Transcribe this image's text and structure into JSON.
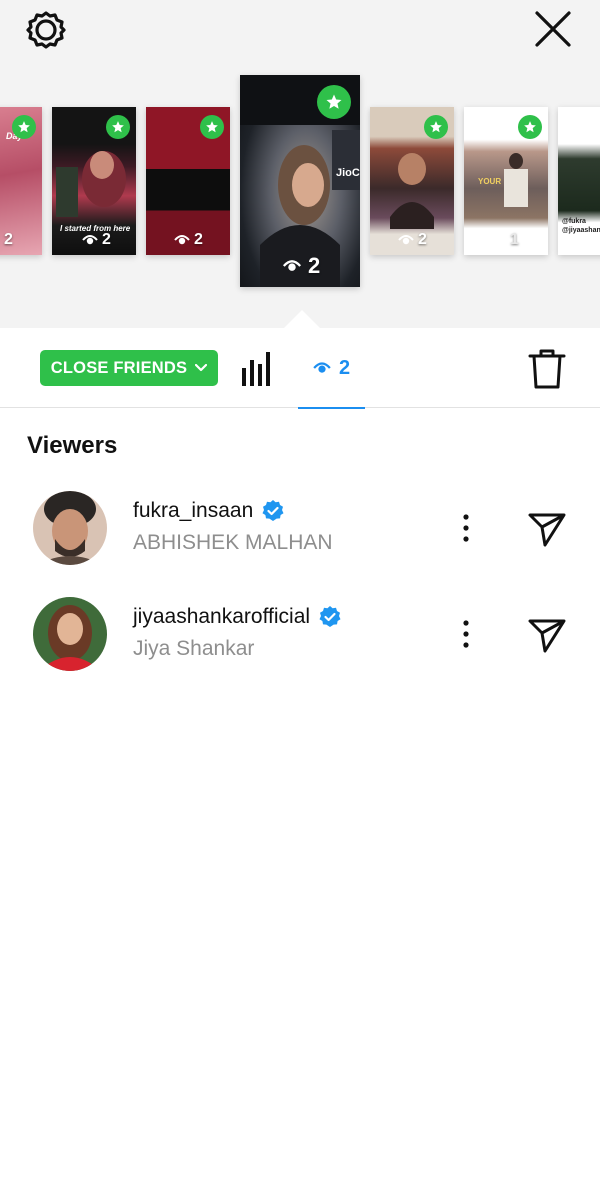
{
  "header": {
    "settings_icon": "gear-icon",
    "close_icon": "close-icon"
  },
  "stories": {
    "items": [
      {
        "caption": "Day",
        "views": "2",
        "close_friends": true
      },
      {
        "caption": "I started from here",
        "views": "2",
        "close_friends": true
      },
      {
        "caption": "",
        "views": "2",
        "close_friends": true
      },
      {
        "caption": "",
        "views": "2",
        "close_friends": true,
        "selected": true,
        "overlay_text": "JioC"
      },
      {
        "caption": "",
        "views": "2",
        "close_friends": true
      },
      {
        "caption": "YOUR",
        "views": "1",
        "close_friends": true
      },
      {
        "caption": "@fukra @jiyaashanka",
        "views": "",
        "close_friends": false
      }
    ]
  },
  "toolbar": {
    "close_friends_label": "CLOSE FRIENDS",
    "insights_icon": "bar-chart-icon",
    "views_count": "2",
    "delete_icon": "trash-icon"
  },
  "viewers": {
    "title": "Viewers",
    "list": [
      {
        "username": "fukra_insaan",
        "full_name": "ABHISHEK MALHAN",
        "verified": true
      },
      {
        "username": "jiyaashankarofficial",
        "full_name": "Jiya Shankar",
        "verified": true
      }
    ]
  },
  "colors": {
    "close_friends_green": "#2fc04a",
    "accent_blue": "#1b8ef0",
    "verified_blue": "#1f96f0",
    "secondary_text": "#8e8e8e"
  }
}
